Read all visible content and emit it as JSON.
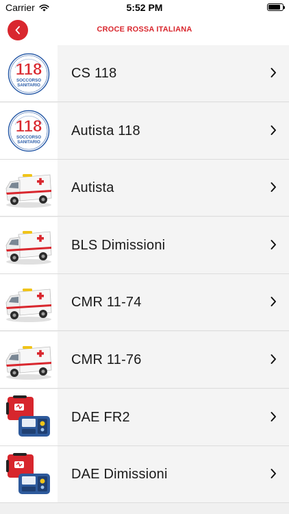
{
  "status_bar": {
    "carrier": "Carrier",
    "time": "5:52 PM",
    "battery_level": 0.85
  },
  "header": {
    "title": "CROCE ROSSA ITALIANA",
    "accent_color": "#d9272e"
  },
  "items": [
    {
      "label": "CS 118",
      "icon": "logo-118-icon"
    },
    {
      "label": "Autista 118",
      "icon": "logo-118-icon"
    },
    {
      "label": "Autista",
      "icon": "ambulance-icon"
    },
    {
      "label": "BLS Dimissioni",
      "icon": "ambulance-icon"
    },
    {
      "label": "CMR 11-74",
      "icon": "ambulance-icon"
    },
    {
      "label": "CMR 11-76",
      "icon": "ambulance-icon"
    },
    {
      "label": "DAE FR2",
      "icon": "defibrillator-icon"
    },
    {
      "label": "DAE Dimissioni",
      "icon": "defibrillator-icon"
    }
  ]
}
